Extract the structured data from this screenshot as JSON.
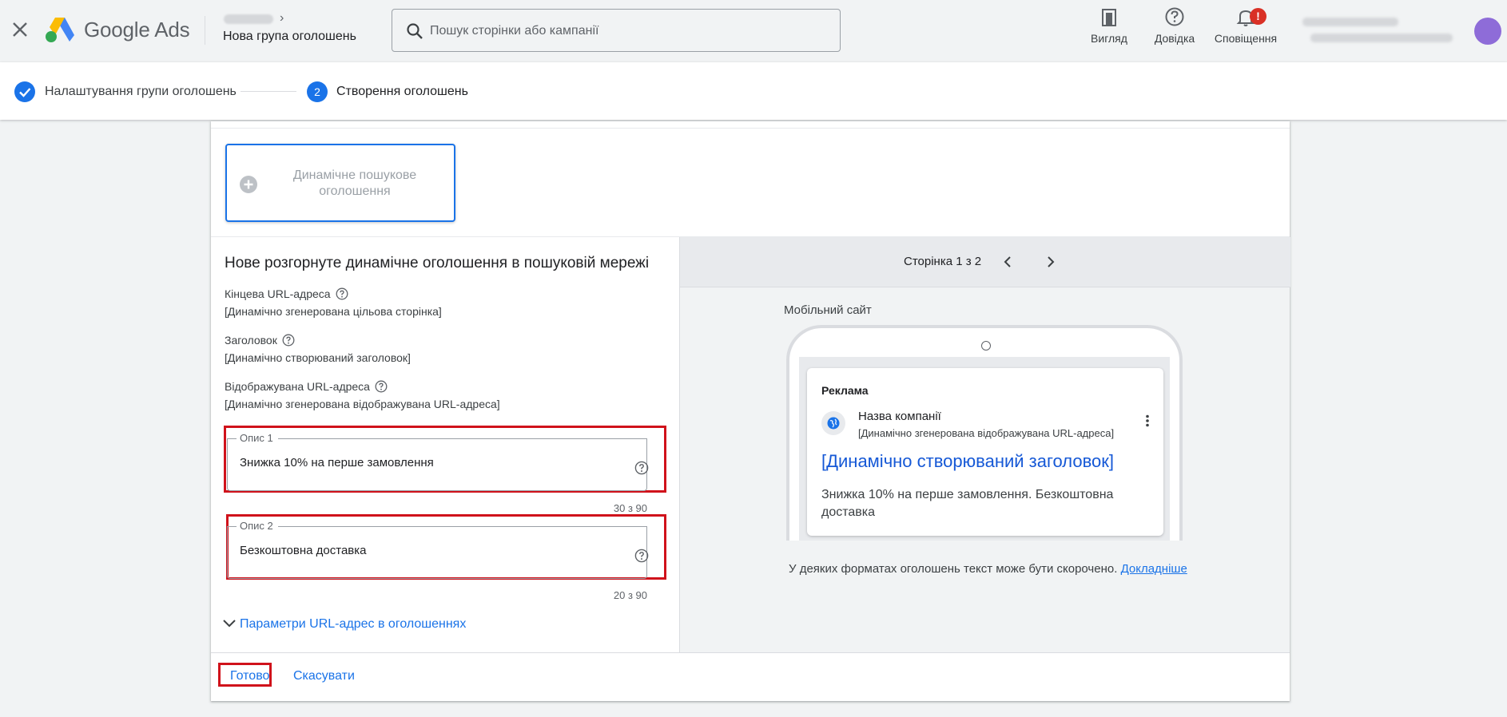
{
  "header": {
    "close_icon": "close-icon",
    "brand": "Google Ads",
    "breadcrumb_title": "Нова група оголошень",
    "search_placeholder": "Пошук сторінки або кампанії",
    "tools": [
      {
        "label": "Вигляд",
        "icon": "view-icon"
      },
      {
        "label": "Довідка",
        "icon": "help-icon"
      },
      {
        "label": "Сповіщення",
        "icon": "bell-icon",
        "badge": "!"
      }
    ]
  },
  "stepper": {
    "step1_label": "Налаштування групи оголошень",
    "step2_number": "2",
    "step2_label": "Створення оголошень"
  },
  "ad_type_tile": {
    "label": "Динамічне пошукове оголошення"
  },
  "form": {
    "title": "Нове розгорнуте динамічне оголошення в пошуковій мережі",
    "final_url_label": "Кінцева URL-адреса",
    "final_url_value": "[Динамічно згенерована цільова сторінка]",
    "headline_label": "Заголовок",
    "headline_value": "[Динамічно створюваний заголовок]",
    "display_url_label": "Відображувана URL-адреса",
    "display_url_value": "[Динамічно згенерована відображувана URL-адреса]",
    "desc1_label": "Опис 1",
    "desc1_value": "Знижка 10% на перше замовлення",
    "desc1_counter": "30 з 90",
    "desc2_label": "Опис 2",
    "desc2_value": "Безкоштовна доставка",
    "desc2_counter": "20 з 90",
    "url_options": "Параметри URL-адрес в оголошеннях"
  },
  "preview": {
    "page_indicator": "Сторінка 1 з 2",
    "device_label": "Мобільний сайт",
    "ad_tag": "Реклама",
    "company": "Назва компанії",
    "display_url": "[Динамічно згенерована відображувана URL-адреса]",
    "headline": "[Динамічно створюваний заголовок]",
    "description": "Знижка 10% на перше замовлення. Безкоштовна доставка",
    "note": "У деяких форматах оголошень текст може бути скорочено.",
    "note_link": "Докладніше"
  },
  "footer": {
    "done": "Готово",
    "cancel": "Скасувати"
  },
  "colors": {
    "accent": "#1a73e8",
    "highlight": "#d0121b",
    "badge": "#d93025"
  }
}
